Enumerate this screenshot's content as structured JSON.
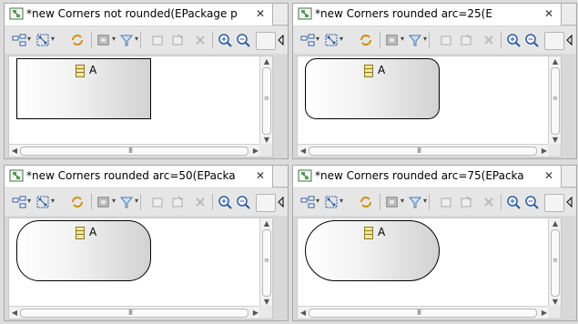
{
  "editors": [
    {
      "title": "*new Corners not rounded(EPackage p",
      "node_label": "A",
      "corner_arc": 0
    },
    {
      "title": "*new Corners rounded arc=25(E",
      "node_label": "A",
      "corner_arc": 25
    },
    {
      "title": "*new Corners rounded arc=50(EPacka",
      "node_label": "A",
      "corner_arc": 50
    },
    {
      "title": "*new Corners rounded arc=75(EPacka",
      "node_label": "A",
      "corner_arc": 75
    }
  ],
  "icons": {
    "tab": "diagram-editor-icon",
    "close": "close-icon",
    "toolbar": [
      "select-all-icon",
      "arrange-all-icon",
      "refresh-icon",
      "layer-icon",
      "filter-icon",
      "copy-format-icon",
      "paste-format-icon",
      "delete-icon",
      "zoom-in-icon",
      "zoom-out-icon"
    ],
    "node": "eclass-icon"
  },
  "colors": {
    "node_border": "#000000",
    "node_gradient_end": "#d2d2d2",
    "canvas": "#ffffff"
  }
}
